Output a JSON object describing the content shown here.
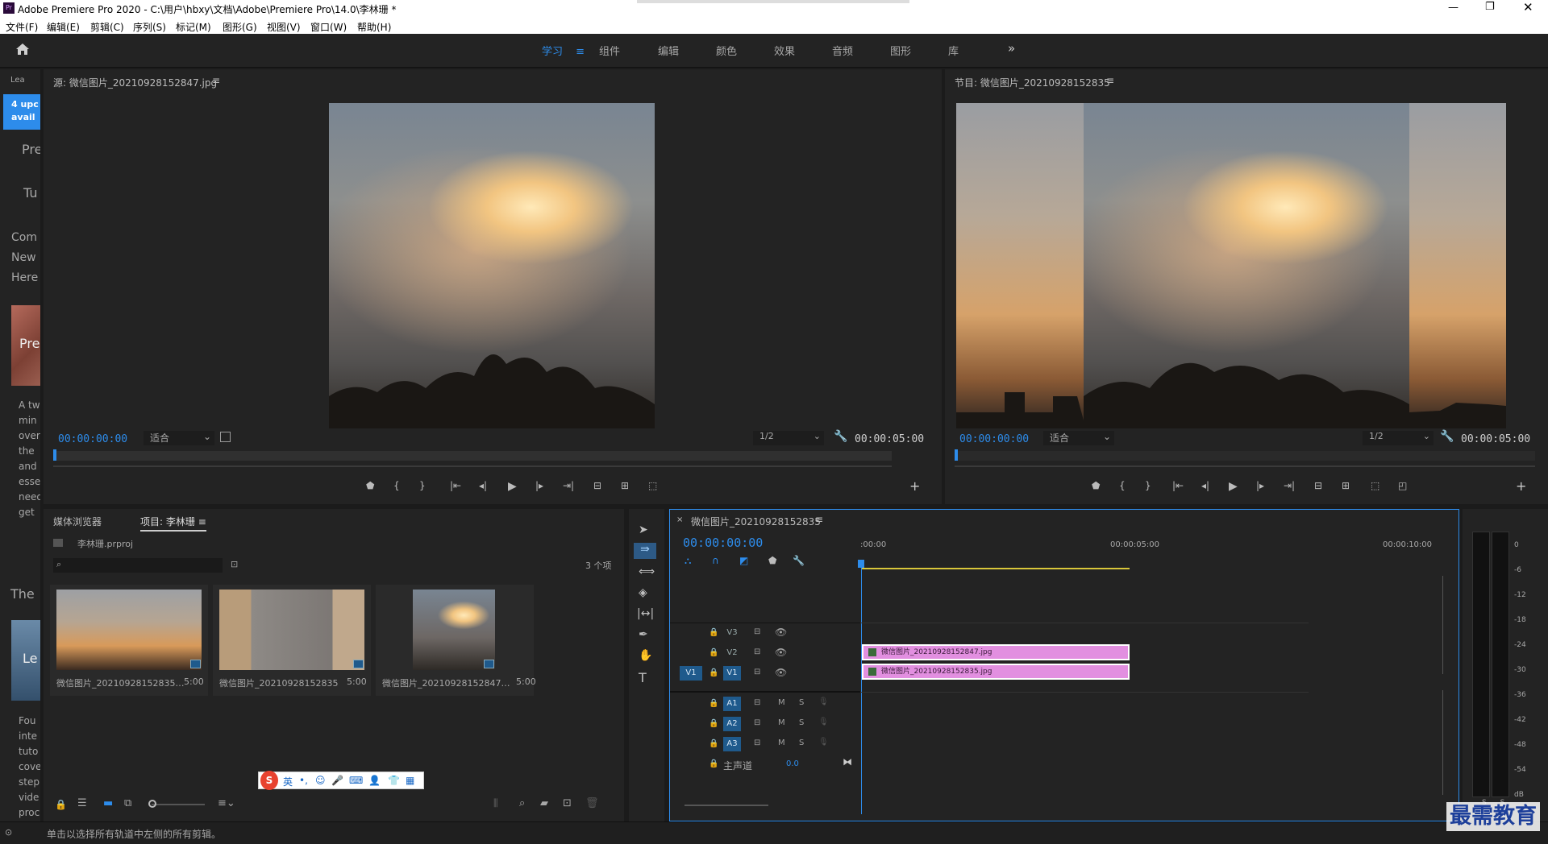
{
  "window": {
    "title": "Adobe Premiere Pro 2020 - C:\\用户\\hbxy\\文档\\Adobe\\Premiere Pro\\14.0\\李林珊 *",
    "app_badge": "Pr"
  },
  "menu": [
    "文件(F)",
    "编辑(E)",
    "剪辑(C)",
    "序列(S)",
    "标记(M)",
    "图形(G)",
    "视图(V)",
    "窗口(W)",
    "帮助(H)"
  ],
  "workspaces": {
    "items": [
      "学习",
      "组件",
      "编辑",
      "颜色",
      "效果",
      "音频",
      "图形",
      "库"
    ],
    "active": "学习",
    "more": "»"
  },
  "learn": {
    "tab": "Lea",
    "badge_line1": "4 upc",
    "badge_line2": "avail",
    "texts": [
      "Pre",
      "Tu",
      "Com",
      "New",
      "Here",
      "Pre",
      "The",
      "Le"
    ],
    "para1": [
      "A tw",
      "min",
      "over",
      "the",
      "and",
      "esse",
      "need",
      "get"
    ],
    "para2": [
      "Fou",
      "inte",
      "tuto",
      "cove",
      "step",
      "vide",
      "proc"
    ]
  },
  "source": {
    "title": "源: 微信图片_20210928152847.jpg",
    "timecode": "00:00:00:00",
    "fit": "适合",
    "ratio": "1/2",
    "duration": "00:00:05:00"
  },
  "program": {
    "title": "节目: 微信图片_20210928152835",
    "timecode": "00:00:00:00",
    "fit": "适合",
    "ratio": "1/2",
    "duration": "00:00:05:00"
  },
  "project": {
    "tab_media": "媒体浏览器",
    "tab_project": "项目: 李林珊",
    "file": "李林珊.prproj",
    "count": "3 个项",
    "items": [
      {
        "name": "微信图片_20210928152835…",
        "dur": "5:00"
      },
      {
        "name": "微信图片_20210928152835",
        "dur": "5:00"
      },
      {
        "name": "微信图片_20210928152847…",
        "dur": "5:00"
      }
    ]
  },
  "timeline": {
    "title": "微信图片_20210928152835",
    "timecode": "00:00:00:00",
    "ruler": [
      ":00:00",
      "00:00:05:00",
      "00:00:10:00"
    ],
    "video_tracks": [
      "V3",
      "V2",
      "V1"
    ],
    "audio_tracks": [
      "A1",
      "A2",
      "A3"
    ],
    "src_v": "V1",
    "master": "主声道",
    "master_val": "0.0",
    "clips": [
      {
        "track": "V2",
        "name": "微信图片_20210928152847.jpg"
      },
      {
        "track": "V1",
        "name": "微信图片_20210928152835.jpg"
      }
    ]
  },
  "meter": {
    "labels": [
      "0",
      "-6",
      "-12",
      "-18",
      "-24",
      "-30",
      "-36",
      "-42",
      "-48",
      "-54",
      "dB"
    ],
    "ss": "S S"
  },
  "ime": {
    "items": [
      "英",
      "•,",
      "☺",
      "🎤",
      "⌨",
      "👤",
      "👕",
      "▦"
    ]
  },
  "status": "单击以选择所有轨道中左侧的所有剪辑。",
  "watermark": "最需教育",
  "colors": {
    "accent": "#2d8ceb",
    "clip": "#e28fe0",
    "panel": "#232323",
    "bg": "#1b1b1b"
  }
}
